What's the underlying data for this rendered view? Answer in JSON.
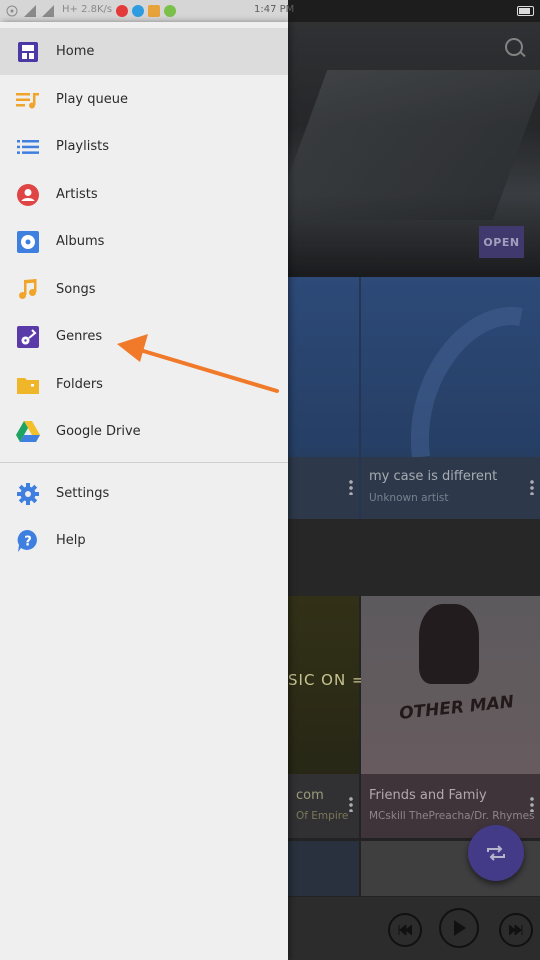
{
  "status_bar": {
    "network": "H+ 2.8K/s",
    "time": "1:47 PM"
  },
  "drawer": {
    "items": [
      {
        "label": "Home",
        "icon": "home-icon",
        "active": true
      },
      {
        "label": "Play queue",
        "icon": "play-queue-icon"
      },
      {
        "label": "Playlists",
        "icon": "playlists-icon"
      },
      {
        "label": "Artists",
        "icon": "artists-icon"
      },
      {
        "label": "Albums",
        "icon": "albums-icon"
      },
      {
        "label": "Songs",
        "icon": "songs-icon"
      },
      {
        "label": "Genres",
        "icon": "genres-icon"
      },
      {
        "label": "Folders",
        "icon": "folders-icon"
      },
      {
        "label": "Google Drive",
        "icon": "google-drive-icon"
      }
    ],
    "secondary": [
      {
        "label": "Settings",
        "icon": "settings-icon"
      },
      {
        "label": "Help",
        "icon": "help-icon"
      }
    ]
  },
  "background": {
    "open_button": "OPEN",
    "top_tiles": [
      {
        "title": "",
        "subtitle": ""
      },
      {
        "title": "my case is different",
        "subtitle": "Unknown artist"
      }
    ],
    "bottom_tiles": [
      {
        "title": "com",
        "subtitle": "Of Empire",
        "art_text": "SIC ON ="
      },
      {
        "title": "Friends and Famiy",
        "subtitle": "MCskill ThePreacha/Dr. Rhymes",
        "art_text": "OTHER MAN"
      }
    ]
  },
  "colors": {
    "accent": "#4f45a0",
    "arrow": "#f07a2a",
    "drawer_bg": "#efefef"
  }
}
